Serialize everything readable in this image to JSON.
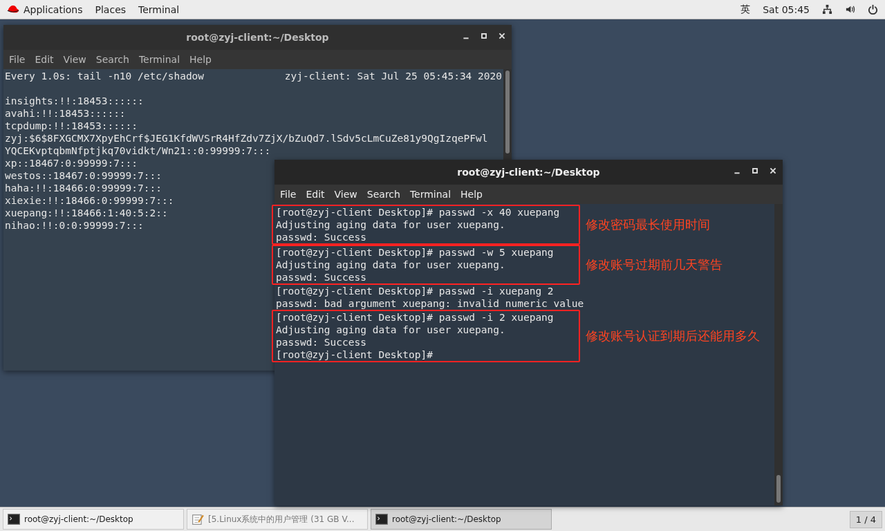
{
  "top_bar": {
    "menus": [
      "Applications",
      "Places",
      "Terminal"
    ],
    "input_method": "英",
    "clock": "Sat 05:45"
  },
  "windows": [
    {
      "title": "root@zyj-client:~/Desktop",
      "focused": false,
      "menu": [
        "File",
        "Edit",
        "View",
        "Search",
        "Terminal",
        "Help"
      ],
      "header": {
        "command": "Every 1.0s: tail -n10 /etc/shadow",
        "host_time": "zyj-client: Sat Jul 25 05:45:34 2020"
      },
      "blocks": [
        {
          "lines": [
            "insights:!!:18453::::::",
            "avahi:!!:18453::::::",
            "tcpdump:!!:18453::::::",
            "zyj:$6$8FXGCMX7XpyEhCrf$JEG1KfdWVSrR4HfZdv7ZjX/bZuQd7.lSdv5cLmCuZe81y9QgIzqePFwl",
            "YQCEKvptqbmNfptjkq70vidkt/Wn21::0:99999:7:::",
            "xp::18467:0:99999:7:::",
            "westos::18467:0:99999:7:::",
            "haha:!!:18466:0:99999:7:::",
            "xiexie:!!:18466:0:99999:7:::",
            "xuepang:!!:18466:1:40:5:2::",
            "nihao:!!:0:0:99999:7:::"
          ]
        }
      ]
    },
    {
      "title": "root@zyj-client:~/Desktop",
      "focused": true,
      "menu": [
        "File",
        "Edit",
        "View",
        "Search",
        "Terminal",
        "Help"
      ],
      "blocks": [
        {
          "lines": [
            "[root@zyj-client Desktop]# passwd -x 40 xuepang",
            "Adjusting aging data for user xuepang.",
            "passwd: Success"
          ],
          "annotation": "修改密码最长使用时间"
        },
        {
          "lines": [
            "[root@zyj-client Desktop]# passwd -w 5 xuepang",
            "Adjusting aging data for user xuepang.",
            "passwd: Success"
          ],
          "annotation": "修改账号过期前几天警告"
        },
        {
          "lines": [
            "[root@zyj-client Desktop]# passwd -i xuepang 2",
            "passwd: bad argument xuepang: invalid numeric value"
          ]
        },
        {
          "lines": [
            "[root@zyj-client Desktop]# passwd -i 2 xuepang",
            "Adjusting aging data for user xuepang.",
            "passwd: Success",
            "[root@zyj-client Desktop]#"
          ],
          "annotation": "修改账号认证到期后还能用多久"
        }
      ]
    }
  ],
  "taskbar": {
    "items": [
      {
        "label": "root@zyj-client:~/Desktop",
        "kind": "terminal",
        "selected": false
      },
      {
        "label": "[5.Linux系统中的用户管理 (31 GB V...",
        "kind": "editor",
        "selected": false
      },
      {
        "label": "root@zyj-client:~/Desktop",
        "kind": "terminal",
        "selected": true
      }
    ],
    "workspace": "1 / 4"
  }
}
